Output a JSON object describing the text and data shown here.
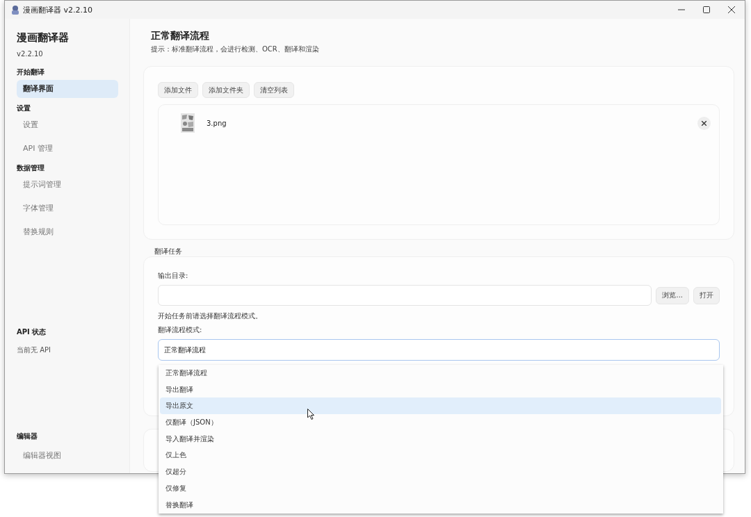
{
  "window": {
    "title": "漫画翻译器 v2.2.10"
  },
  "sidebar": {
    "app_name": "漫画翻译器",
    "version": "v2.2.10",
    "sections": [
      {
        "heading": "开始翻译",
        "items": [
          {
            "label": "翻译界面",
            "selected": true
          }
        ]
      },
      {
        "heading": "设置",
        "items": [
          {
            "label": "设置",
            "selected": false
          },
          {
            "label": "API 管理",
            "selected": false
          }
        ]
      },
      {
        "heading": "数据管理",
        "items": [
          {
            "label": "提示词管理",
            "selected": false
          },
          {
            "label": "字体管理",
            "selected": false
          },
          {
            "label": "替换规则",
            "selected": false
          }
        ]
      }
    ],
    "api_status": {
      "heading": "API 状态",
      "text": "当前无 API"
    },
    "bottom_section": {
      "heading": "编辑器",
      "items": [
        {
          "label": "编辑器视图",
          "selected": false
        }
      ]
    }
  },
  "page": {
    "title": "正常翻译流程",
    "hint": "提示：标准翻译流程，会进行检测、OCR、翻译和渲染"
  },
  "file_panel": {
    "buttons": [
      "添加文件",
      "添加文件夹",
      "清空列表"
    ],
    "files": [
      {
        "name": "3.png"
      }
    ]
  },
  "task_panel": {
    "heading": "翻译任务",
    "output_label": "输出目录:",
    "output_buttons": [
      "浏览...",
      "打开"
    ],
    "notice": "开始任务前请选择翻译流程模式。",
    "mode_label": "翻译流程模式:",
    "mode_value": "正常翻译流程",
    "options": [
      {
        "label": "正常翻译流程",
        "highlighted": false
      },
      {
        "label": "导出翻译",
        "highlighted": false
      },
      {
        "label": "导出原文",
        "highlighted": true
      },
      {
        "label": "仅翻译（JSON）",
        "highlighted": false
      },
      {
        "label": "导入翻译并渲染",
        "highlighted": false
      },
      {
        "label": "仅上色",
        "highlighted": false
      },
      {
        "label": "仅超分",
        "highlighted": false
      },
      {
        "label": "仅修复",
        "highlighted": false
      },
      {
        "label": "替换翻译",
        "highlighted": false
      }
    ]
  }
}
